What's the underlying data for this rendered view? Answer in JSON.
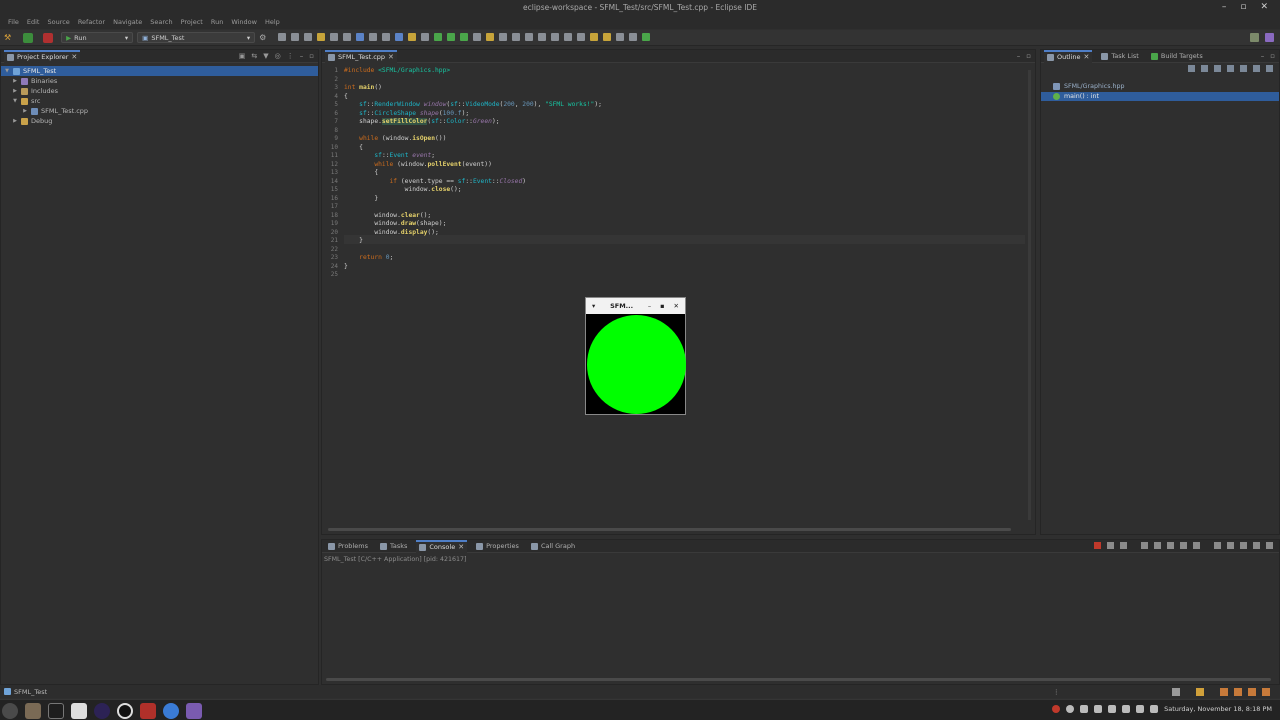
{
  "window": {
    "title": "eclipse-workspace - SFML_Test/src/SFML_Test.cpp - Eclipse IDE"
  },
  "menu": [
    "File",
    "Edit",
    "Source",
    "Refactor",
    "Navigate",
    "Search",
    "Project",
    "Run",
    "Window",
    "Help"
  ],
  "toolbar": {
    "launch_mode": "Run",
    "launch_config": "SFML_Test"
  },
  "explorer": {
    "tab_label": "Project Explorer",
    "items": [
      {
        "label": "SFML_Test",
        "depth": 0,
        "expanded": true,
        "selected": true
      },
      {
        "label": "Binaries",
        "depth": 1,
        "expanded": false
      },
      {
        "label": "Includes",
        "depth": 1,
        "expanded": false
      },
      {
        "label": "src",
        "depth": 1,
        "expanded": true
      },
      {
        "label": "SFML_Test.cpp",
        "depth": 2,
        "expanded": false
      },
      {
        "label": "Debug",
        "depth": 1,
        "expanded": false
      }
    ]
  },
  "editor": {
    "tab_label": "SFML_Test.cpp",
    "lines": [
      "1",
      "2",
      "3",
      "4",
      "5",
      "6",
      "7",
      "8",
      "9",
      "10",
      "11",
      "12",
      "13",
      "14",
      "15",
      "16",
      "17",
      "18",
      "19",
      "20",
      "21",
      "22",
      "23",
      "24",
      "25"
    ]
  },
  "sfml_window": {
    "title": "SFM...",
    "circle_color": "#00ff00"
  },
  "outline": {
    "tabs": [
      "Outline",
      "Task List",
      "Build Targets"
    ],
    "items": [
      "SFML/Graphics.hpp",
      "main() : int"
    ]
  },
  "bottom": {
    "tabs": [
      "Problems",
      "Tasks",
      "Console",
      "Properties",
      "Call Graph"
    ],
    "console_text": "SFML_Test [C/C++ Application] [pid: 421617]"
  },
  "status": {
    "selected": "SFML_Test"
  },
  "taskbar": {
    "clock": "Saturday, November 18,   8:18 PM"
  }
}
